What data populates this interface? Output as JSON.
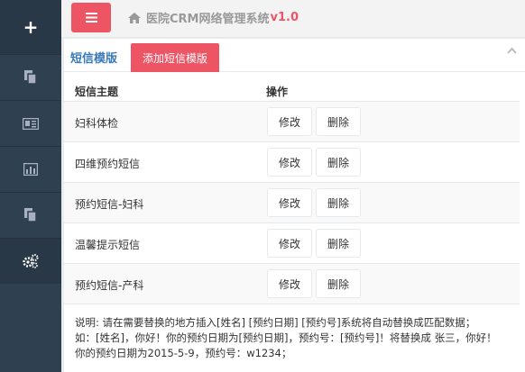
{
  "header": {
    "title": "医院CRM网络管理系统",
    "version": "v1.0",
    "menu_icon": "bars-icon",
    "home_icon": "home-icon"
  },
  "sidebar": {
    "items": [
      {
        "name": "plus",
        "icon": "plus-icon"
      },
      {
        "name": "pages",
        "icon": "copy-icon"
      },
      {
        "name": "contact",
        "icon": "id-card-icon"
      },
      {
        "name": "stats",
        "icon": "bar-chart-icon"
      },
      {
        "name": "files",
        "icon": "copy-icon"
      },
      {
        "name": "settings",
        "icon": "cogs-icon"
      }
    ]
  },
  "panel": {
    "title": "短信模版",
    "add_label": "添加短信模版",
    "col_subject": "短信主题",
    "col_action": "操作",
    "edit_label": "修改",
    "delete_label": "删除",
    "rows": [
      {
        "subject": "妇科体检"
      },
      {
        "subject": "四维预约短信"
      },
      {
        "subject": "预约短信-妇科"
      },
      {
        "subject": "温馨提示短信"
      },
      {
        "subject": "预约短信-产科"
      }
    ],
    "note_line1": "说明: 请在需要替换的地方插入[姓名] [预约日期] [预约号]系统将自动替换成匹配数据；",
    "note_line2": "如：[姓名]，你好！你的预约日期为[预约日期]，预约号：[预约号]！将替换成 张三，你好！",
    "note_line3": "你的预约日期为2015-5-9，预约号：w1234；"
  },
  "colors": {
    "accent": "#ed5565",
    "sidebar": "#2f4050",
    "title_blue": "#3a7ab8"
  }
}
